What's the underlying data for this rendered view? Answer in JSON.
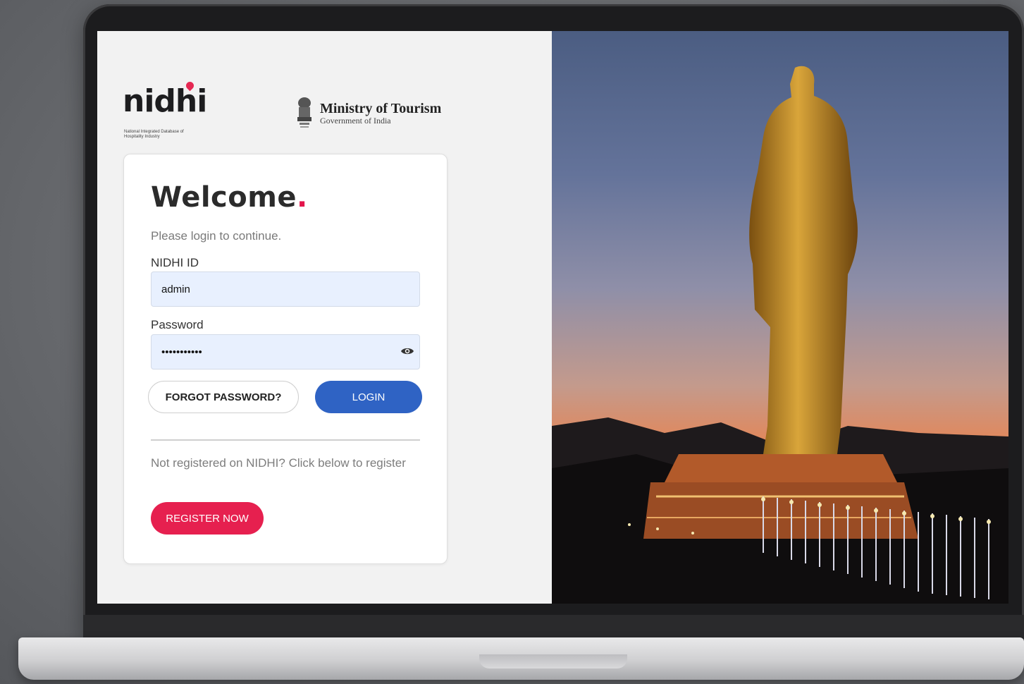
{
  "brand": {
    "nidhi_word": "nidhi",
    "nidhi_tagline": "National Integrated Database of Hospitality Industry",
    "ministry_title": "Ministry of Tourism",
    "ministry_subtitle": "Government of India"
  },
  "login": {
    "welcome": "Welcome",
    "welcome_dot": ".",
    "subtitle": "Please login to continue.",
    "id_label": "NIDHI ID",
    "id_value": "admin",
    "password_label": "Password",
    "password_value": "•••••••••••",
    "forgot_label": "FORGOT PASSWORD?",
    "login_label": "LOGIN",
    "register_note": "Not registered on NIDHI? Click below to register",
    "register_label": "REGISTER NOW"
  },
  "colors": {
    "accent_red": "#e6204f",
    "login_blue": "#2f63c4",
    "input_bg": "#e8f0fe"
  },
  "icons": {
    "eye": "eye-icon",
    "pin": "location-pin-icon",
    "emblem": "state-emblem-icon"
  }
}
